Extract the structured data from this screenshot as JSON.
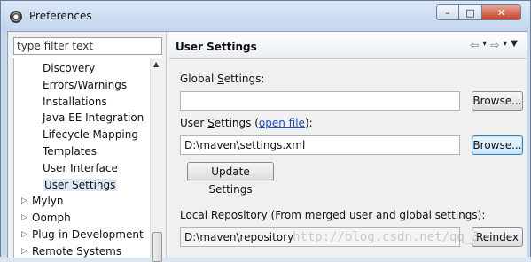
{
  "window": {
    "title": "Preferences",
    "controls": {
      "minimize": "–",
      "maximize": "□",
      "close": "✕"
    }
  },
  "filter": {
    "placeholder": "type filter text"
  },
  "tree": {
    "items": [
      {
        "label": "Discovery",
        "expandable": false
      },
      {
        "label": "Errors/Warnings",
        "expandable": false
      },
      {
        "label": "Installations",
        "expandable": false
      },
      {
        "label": "Java EE Integration",
        "expandable": false
      },
      {
        "label": "Lifecycle Mapping",
        "expandable": false
      },
      {
        "label": "Templates",
        "expandable": false
      },
      {
        "label": "User Interface",
        "expandable": false
      },
      {
        "label": "User Settings",
        "expandable": false,
        "selected": true
      },
      {
        "label": "Mylyn",
        "expandable": true
      },
      {
        "label": "Oomph",
        "expandable": true
      },
      {
        "label": "Plug-in Development",
        "expandable": true
      },
      {
        "label": "Remote Systems",
        "expandable": true
      }
    ]
  },
  "page": {
    "title": "User Settings",
    "nav_icons": [
      "back-arrow-icon",
      "forward-arrow-icon",
      "view-menu-icon"
    ]
  },
  "global_settings": {
    "label_pre": "Global ",
    "label_mnemonic": "S",
    "label_post": "ettings:",
    "value": "",
    "browse_label": "Browse..."
  },
  "user_settings": {
    "label_pre": "User ",
    "label_mnemonic": "S",
    "label_post": "ettings (",
    "link_text": "open file",
    "label_end": "):",
    "value": "D:\\maven\\settings.xml",
    "browse_label": "Browse...",
    "update_label": "Update Settings"
  },
  "local_repository": {
    "label": "Local Repository (From merged user and global settings):",
    "value": "D:\\maven\\repository",
    "reindex_label": "Reindex"
  },
  "watermark": "http://blog.csdn.net/qq_3"
}
